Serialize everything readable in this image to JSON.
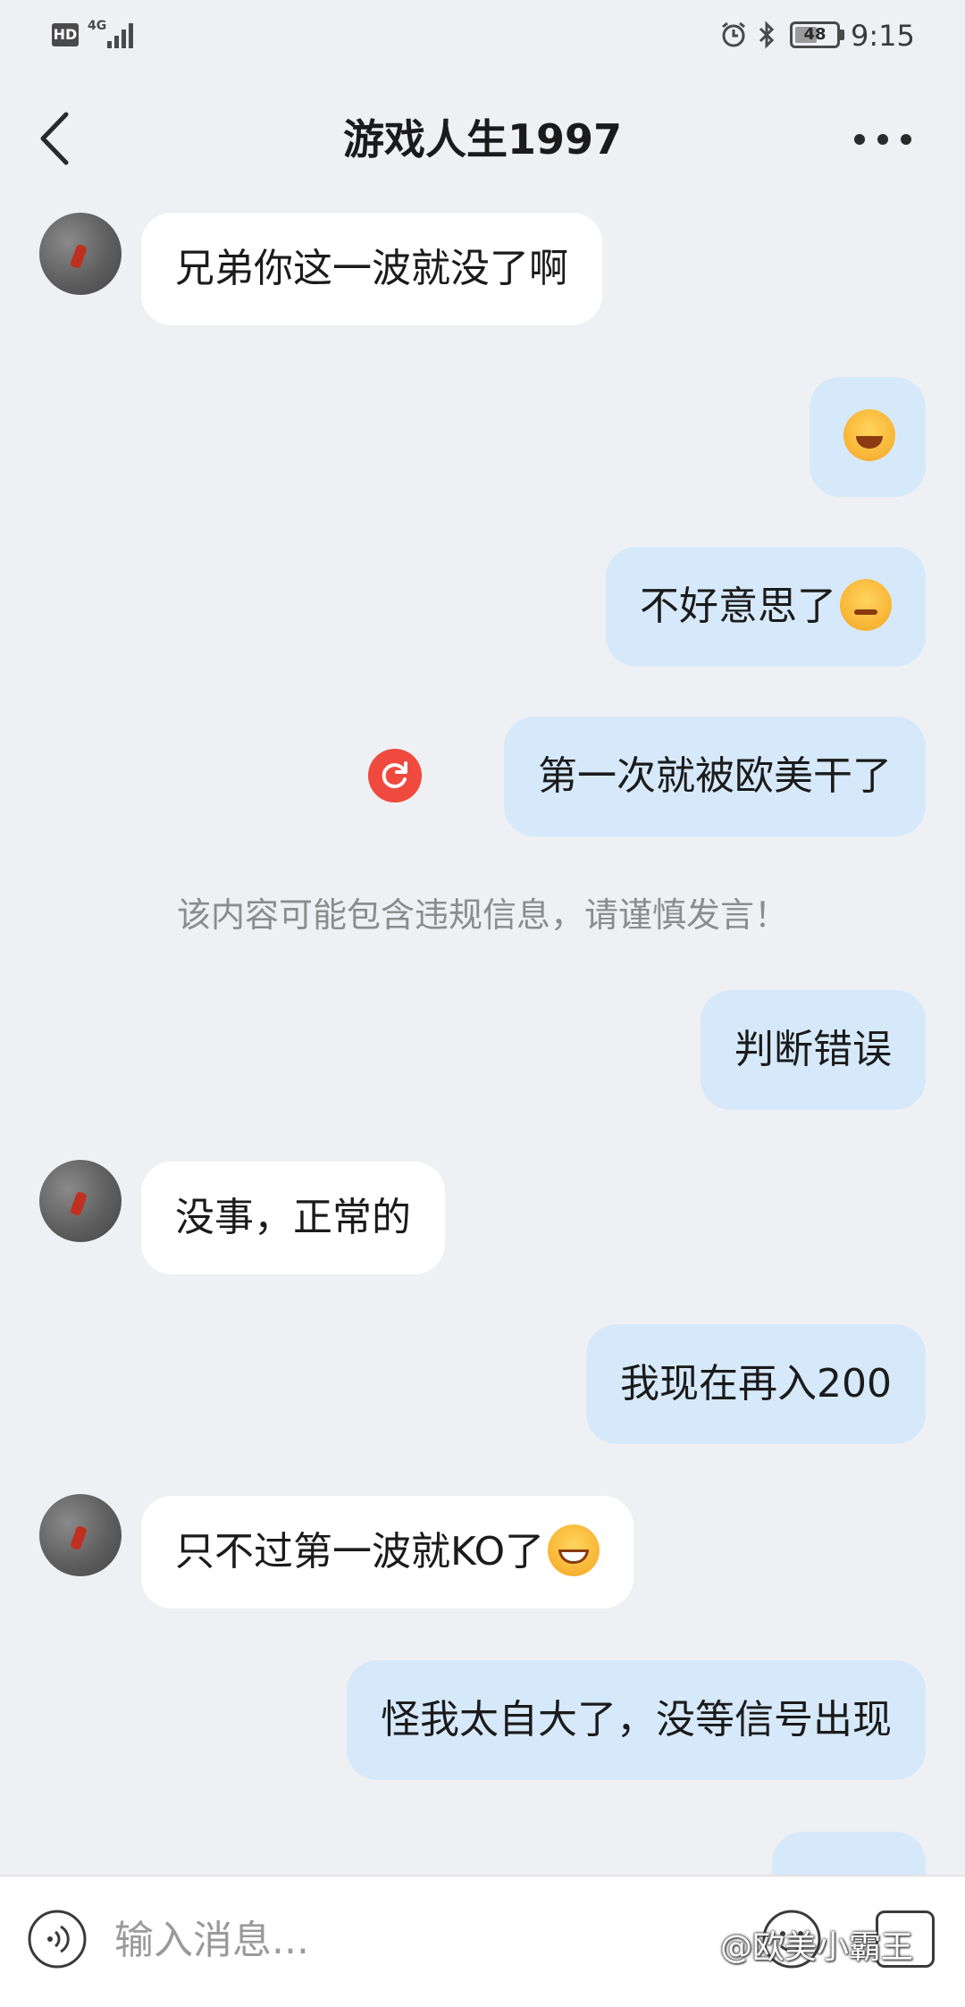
{
  "status_bar": {
    "hd": "HD",
    "network": "4G",
    "battery": "48",
    "time": "9:15"
  },
  "header": {
    "title": "游戏人生1997"
  },
  "messages": [
    {
      "side": "in",
      "text": "兄弟你这一波就没了啊"
    },
    {
      "side": "out",
      "text": "",
      "emoji": "tears-of-joy-emoji"
    },
    {
      "side": "out",
      "text": "不好意思了",
      "emoji": "huffing-emoji"
    },
    {
      "side": "out",
      "text": "第一次就被欧美干了",
      "status": "resend-icon"
    },
    {
      "side": "system",
      "text": "该内容可能包含违规信息，请谨慎发言！"
    },
    {
      "side": "out",
      "text": "判断错误"
    },
    {
      "side": "in",
      "text": "没事，正常的"
    },
    {
      "side": "out",
      "text": "我现在再入200"
    },
    {
      "side": "in",
      "text": "只不过第一波就KO了",
      "emoji": "grin-emoji"
    },
    {
      "side": "out",
      "text": "怪我太自大了，没等信号出现"
    }
  ],
  "input_bar": {
    "placeholder": "输入消息..."
  },
  "watermark": "@欧美小霸王",
  "colors": {
    "background": "#eef0f3",
    "incoming_bubble": "#ffffff",
    "outgoing_bubble": "#d6e9fb",
    "resend": "#f04a3e",
    "warning_text": "#8c8c8c"
  }
}
